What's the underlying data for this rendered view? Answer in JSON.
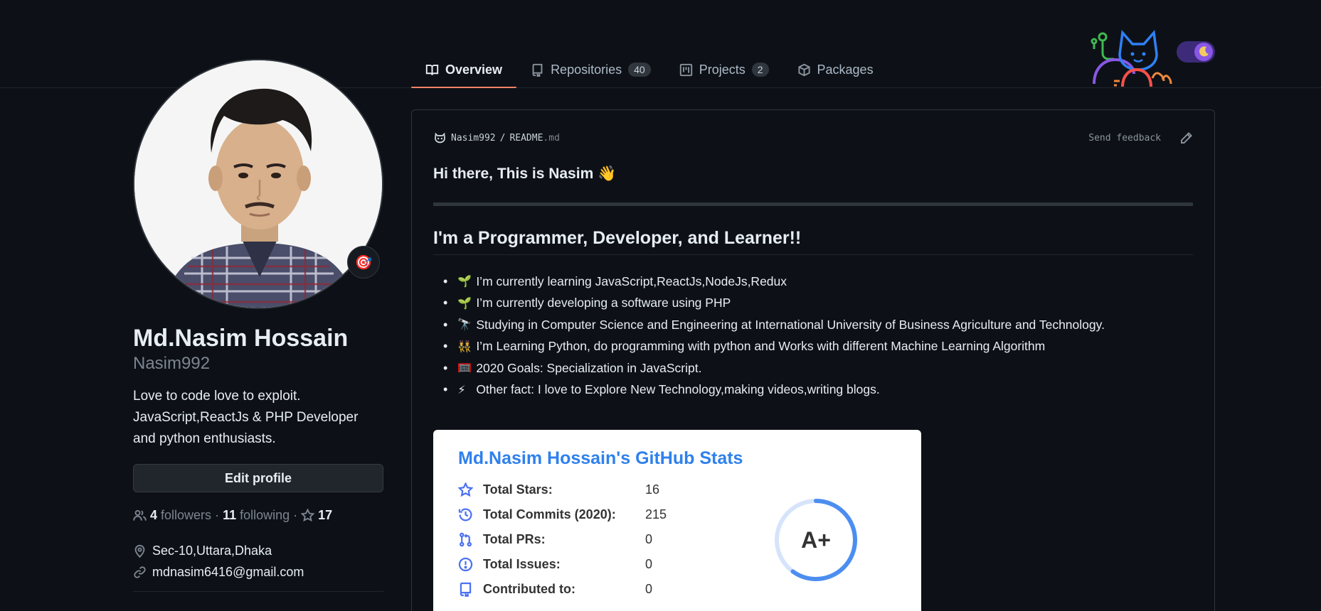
{
  "tabs": [
    {
      "label": "Overview",
      "icon": "book-icon",
      "active": true
    },
    {
      "label": "Repositories",
      "icon": "repo-icon",
      "count": "40"
    },
    {
      "label": "Projects",
      "icon": "project-icon",
      "count": "2"
    },
    {
      "label": "Packages",
      "icon": "package-icon"
    }
  ],
  "profile": {
    "full_name": "Md.Nasim Hossain",
    "login": "Nasim992",
    "bio": "Love to code love to exploit. JavaScript,ReactJs & PHP Developer and python enthusiasts.",
    "edit_label": "Edit profile",
    "status_emoji": "🎯",
    "followers_count": "4",
    "followers_label": "followers",
    "following_count": "11",
    "following_label": "following",
    "stars_count": "17",
    "sep": "·",
    "location": "Sec-10,Uttara,Dhaka",
    "email": "mdnasim6416@gmail.com"
  },
  "readme": {
    "owner": "Nasim992",
    "slash": "/",
    "file": "README",
    "ext": ".md",
    "feedback_label": "Send feedback",
    "greeting": "Hi there, This is Nasim 👋",
    "heading": "I'm a Programmer, Developer, and Learner!!",
    "bullets": [
      {
        "emoji": "🌱",
        "text": "I’m currently learning JavaScript,ReactJs,NodeJs,Redux"
      },
      {
        "emoji": "🌱",
        "text": "I’m currently developing a software using PHP"
      },
      {
        "emoji": "🔭",
        "text": "Studying in Computer Science and Engineering at International University of Business Agriculture and Technology."
      },
      {
        "emoji": "👯",
        "text": "I’m Learning Python, do programming with python and Works with different Machine Learning Algorithm"
      },
      {
        "emoji": "🥅",
        "text": "2020 Goals: Specialization in JavaScript."
      },
      {
        "emoji": "⚡",
        "text": "Other fact: I love to Explore New Technology,making videos,writing blogs."
      }
    ]
  },
  "stats": {
    "title": "Md.Nasim Hossain's GitHub Stats",
    "rows": [
      {
        "icon": "star-icon",
        "label": "Total Stars:",
        "value": "16"
      },
      {
        "icon": "history-icon",
        "label": "Total Commits (2020):",
        "value": "215"
      },
      {
        "icon": "pull-request-icon",
        "label": "Total PRs:",
        "value": "0"
      },
      {
        "icon": "issue-icon",
        "label": "Total Issues:",
        "value": "0"
      },
      {
        "icon": "repo-icon",
        "label": "Contributed to:",
        "value": "0"
      }
    ],
    "grade": "A+",
    "grade_progress": 0.6,
    "accent": "#2f80ed",
    "ring_color": "#4c8ef0"
  },
  "colors": {
    "background": "#0d1117",
    "active_tab_underline": "#f78166",
    "border": "#30363d"
  }
}
